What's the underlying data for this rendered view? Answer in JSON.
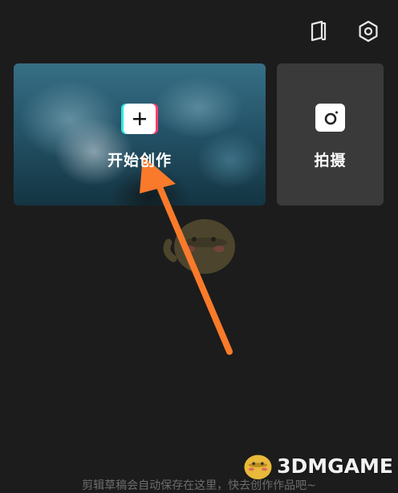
{
  "header": {
    "left_icon": "draft-book-icon",
    "right_icon": "settings-hexagon-icon"
  },
  "create_card": {
    "label": "开始创作",
    "icon": "plus-icon"
  },
  "shoot_card": {
    "label": "拍摄",
    "icon": "camera-icon"
  },
  "empty_state": {
    "hint": "剪辑草稿会自动保存在这里，快去创作作品吧~"
  },
  "watermark": {
    "text": "3DMGAME"
  },
  "colors": {
    "background": "#1c1c1c",
    "card_gray": "#3a3a3a",
    "annotation_arrow": "#f97a2a",
    "accent_cyan": "#35e6e0",
    "accent_pink": "#ff3b6b"
  }
}
